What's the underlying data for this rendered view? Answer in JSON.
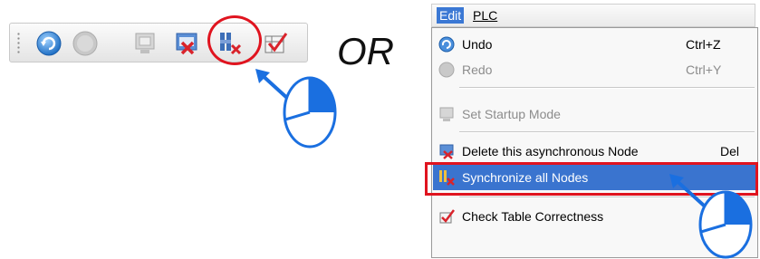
{
  "toolbar": {
    "buttons": [
      {
        "name": "undo",
        "icon": "undo-icon",
        "enabled": true
      },
      {
        "name": "redo",
        "icon": "redo-icon",
        "enabled": false
      },
      {
        "name": "set-startup-mode",
        "icon": "startup-mode-icon",
        "enabled": false
      },
      {
        "name": "delete-node",
        "icon": "delete-node-icon",
        "enabled": true
      },
      {
        "name": "synchronize-all-nodes",
        "icon": "synchronize-nodes-icon",
        "enabled": true,
        "highlighted": true
      },
      {
        "name": "check-table",
        "icon": "check-table-icon",
        "enabled": true
      }
    ]
  },
  "or_label": "OR",
  "menubar": {
    "items": [
      {
        "label": "Edit",
        "active": true
      },
      {
        "label": "PLC",
        "active": false
      }
    ]
  },
  "menu": {
    "items": [
      {
        "label": "Undo",
        "shortcut": "Ctrl+Z",
        "icon": "undo-icon",
        "enabled": true
      },
      {
        "label": "Redo",
        "shortcut": "Ctrl+Y",
        "icon": "redo-icon",
        "enabled": false
      },
      {
        "label": "Set Startup Mode",
        "shortcut": "",
        "icon": "startup-mode-icon",
        "enabled": false
      },
      {
        "label": "Delete this asynchronous Node",
        "shortcut": "Del",
        "icon": "delete-node-icon",
        "enabled": true
      },
      {
        "label": "Synchronize all Nodes",
        "shortcut": "",
        "icon": "synchronize-nodes-icon",
        "enabled": true,
        "highlighted": true
      },
      {
        "label": "Check Table Correctness",
        "shortcut": "",
        "icon": "check-table-icon",
        "enabled": true
      }
    ]
  },
  "colors": {
    "highlight_red": "#e0141f",
    "pointer_blue": "#1a6fe0",
    "menu_selection": "#3a74cf"
  }
}
